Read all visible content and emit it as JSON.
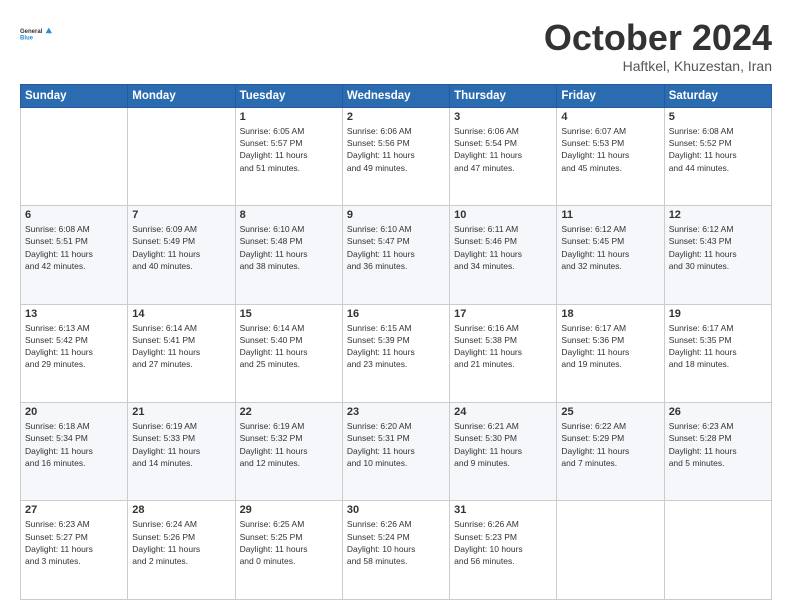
{
  "header": {
    "logo_general": "General",
    "logo_blue": "Blue",
    "month": "October 2024",
    "location": "Haftkel, Khuzestan, Iran"
  },
  "weekdays": [
    "Sunday",
    "Monday",
    "Tuesday",
    "Wednesday",
    "Thursday",
    "Friday",
    "Saturday"
  ],
  "weeks": [
    [
      {
        "day": "",
        "info": ""
      },
      {
        "day": "",
        "info": ""
      },
      {
        "day": "1",
        "info": "Sunrise: 6:05 AM\nSunset: 5:57 PM\nDaylight: 11 hours\nand 51 minutes."
      },
      {
        "day": "2",
        "info": "Sunrise: 6:06 AM\nSunset: 5:56 PM\nDaylight: 11 hours\nand 49 minutes."
      },
      {
        "day": "3",
        "info": "Sunrise: 6:06 AM\nSunset: 5:54 PM\nDaylight: 11 hours\nand 47 minutes."
      },
      {
        "day": "4",
        "info": "Sunrise: 6:07 AM\nSunset: 5:53 PM\nDaylight: 11 hours\nand 45 minutes."
      },
      {
        "day": "5",
        "info": "Sunrise: 6:08 AM\nSunset: 5:52 PM\nDaylight: 11 hours\nand 44 minutes."
      }
    ],
    [
      {
        "day": "6",
        "info": "Sunrise: 6:08 AM\nSunset: 5:51 PM\nDaylight: 11 hours\nand 42 minutes."
      },
      {
        "day": "7",
        "info": "Sunrise: 6:09 AM\nSunset: 5:49 PM\nDaylight: 11 hours\nand 40 minutes."
      },
      {
        "day": "8",
        "info": "Sunrise: 6:10 AM\nSunset: 5:48 PM\nDaylight: 11 hours\nand 38 minutes."
      },
      {
        "day": "9",
        "info": "Sunrise: 6:10 AM\nSunset: 5:47 PM\nDaylight: 11 hours\nand 36 minutes."
      },
      {
        "day": "10",
        "info": "Sunrise: 6:11 AM\nSunset: 5:46 PM\nDaylight: 11 hours\nand 34 minutes."
      },
      {
        "day": "11",
        "info": "Sunrise: 6:12 AM\nSunset: 5:45 PM\nDaylight: 11 hours\nand 32 minutes."
      },
      {
        "day": "12",
        "info": "Sunrise: 6:12 AM\nSunset: 5:43 PM\nDaylight: 11 hours\nand 30 minutes."
      }
    ],
    [
      {
        "day": "13",
        "info": "Sunrise: 6:13 AM\nSunset: 5:42 PM\nDaylight: 11 hours\nand 29 minutes."
      },
      {
        "day": "14",
        "info": "Sunrise: 6:14 AM\nSunset: 5:41 PM\nDaylight: 11 hours\nand 27 minutes."
      },
      {
        "day": "15",
        "info": "Sunrise: 6:14 AM\nSunset: 5:40 PM\nDaylight: 11 hours\nand 25 minutes."
      },
      {
        "day": "16",
        "info": "Sunrise: 6:15 AM\nSunset: 5:39 PM\nDaylight: 11 hours\nand 23 minutes."
      },
      {
        "day": "17",
        "info": "Sunrise: 6:16 AM\nSunset: 5:38 PM\nDaylight: 11 hours\nand 21 minutes."
      },
      {
        "day": "18",
        "info": "Sunrise: 6:17 AM\nSunset: 5:36 PM\nDaylight: 11 hours\nand 19 minutes."
      },
      {
        "day": "19",
        "info": "Sunrise: 6:17 AM\nSunset: 5:35 PM\nDaylight: 11 hours\nand 18 minutes."
      }
    ],
    [
      {
        "day": "20",
        "info": "Sunrise: 6:18 AM\nSunset: 5:34 PM\nDaylight: 11 hours\nand 16 minutes."
      },
      {
        "day": "21",
        "info": "Sunrise: 6:19 AM\nSunset: 5:33 PM\nDaylight: 11 hours\nand 14 minutes."
      },
      {
        "day": "22",
        "info": "Sunrise: 6:19 AM\nSunset: 5:32 PM\nDaylight: 11 hours\nand 12 minutes."
      },
      {
        "day": "23",
        "info": "Sunrise: 6:20 AM\nSunset: 5:31 PM\nDaylight: 11 hours\nand 10 minutes."
      },
      {
        "day": "24",
        "info": "Sunrise: 6:21 AM\nSunset: 5:30 PM\nDaylight: 11 hours\nand 9 minutes."
      },
      {
        "day": "25",
        "info": "Sunrise: 6:22 AM\nSunset: 5:29 PM\nDaylight: 11 hours\nand 7 minutes."
      },
      {
        "day": "26",
        "info": "Sunrise: 6:23 AM\nSunset: 5:28 PM\nDaylight: 11 hours\nand 5 minutes."
      }
    ],
    [
      {
        "day": "27",
        "info": "Sunrise: 6:23 AM\nSunset: 5:27 PM\nDaylight: 11 hours\nand 3 minutes."
      },
      {
        "day": "28",
        "info": "Sunrise: 6:24 AM\nSunset: 5:26 PM\nDaylight: 11 hours\nand 2 minutes."
      },
      {
        "day": "29",
        "info": "Sunrise: 6:25 AM\nSunset: 5:25 PM\nDaylight: 11 hours\nand 0 minutes."
      },
      {
        "day": "30",
        "info": "Sunrise: 6:26 AM\nSunset: 5:24 PM\nDaylight: 10 hours\nand 58 minutes."
      },
      {
        "day": "31",
        "info": "Sunrise: 6:26 AM\nSunset: 5:23 PM\nDaylight: 10 hours\nand 56 minutes."
      },
      {
        "day": "",
        "info": ""
      },
      {
        "day": "",
        "info": ""
      }
    ]
  ]
}
